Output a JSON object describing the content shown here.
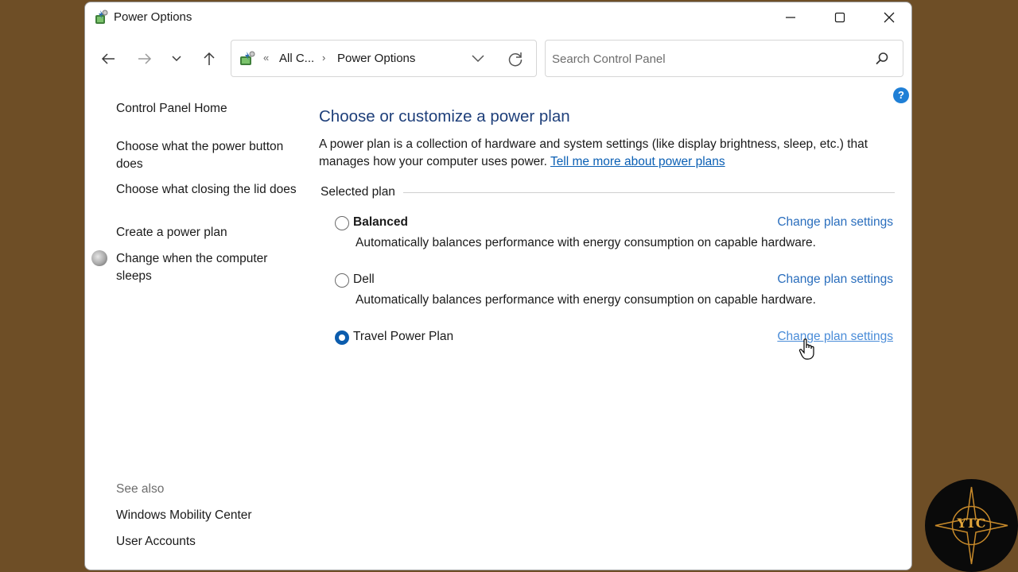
{
  "window": {
    "title": "Power Options"
  },
  "address": {
    "overflow": "«",
    "crumbs": [
      "All C...",
      "Power Options"
    ],
    "separator": "›"
  },
  "search": {
    "placeholder": "Search Control Panel"
  },
  "help": {
    "label": "?"
  },
  "sidebar": {
    "home": "Control Panel Home",
    "links": [
      "Choose what the power button does",
      "Choose what closing the lid does",
      "Create a power plan",
      "Change when the computer sleeps"
    ],
    "see_also": "See also",
    "see_also_links": [
      "Windows Mobility Center",
      "User Accounts"
    ]
  },
  "main": {
    "heading": "Choose or customize a power plan",
    "description": "A power plan is a collection of hardware and system settings (like display brightness, sleep, etc.) that manages how your computer uses power.",
    "learn_more": "Tell me more about power plans",
    "group_label": "Selected plan",
    "plans": [
      {
        "name": "Balanced",
        "selected": false,
        "link": "Change plan settings",
        "description": "Automatically balances performance with energy consumption on capable hardware."
      },
      {
        "name": "Dell",
        "selected": false,
        "link": "Change plan settings",
        "description": "Automatically balances performance with energy consumption on capable hardware."
      },
      {
        "name": "Travel Power Plan",
        "selected": true,
        "link": "Change plan settings",
        "description": ""
      }
    ]
  },
  "watermark": {
    "text": "YTC"
  },
  "colors": {
    "accent": "#0b5cad",
    "link": "#2a6ebd",
    "heading": "#1e3f7a",
    "background": "#6e4e26"
  },
  "icons": [
    "power-options-icon",
    "minimize-icon",
    "maximize-icon",
    "close-icon",
    "back-arrow-icon",
    "forward-arrow-icon",
    "recent-dropdown-icon",
    "up-arrow-icon",
    "control-panel-icon",
    "address-dropdown-icon",
    "refresh-icon",
    "search-icon",
    "help-icon",
    "moon-icon",
    "hand-cursor-icon"
  ]
}
